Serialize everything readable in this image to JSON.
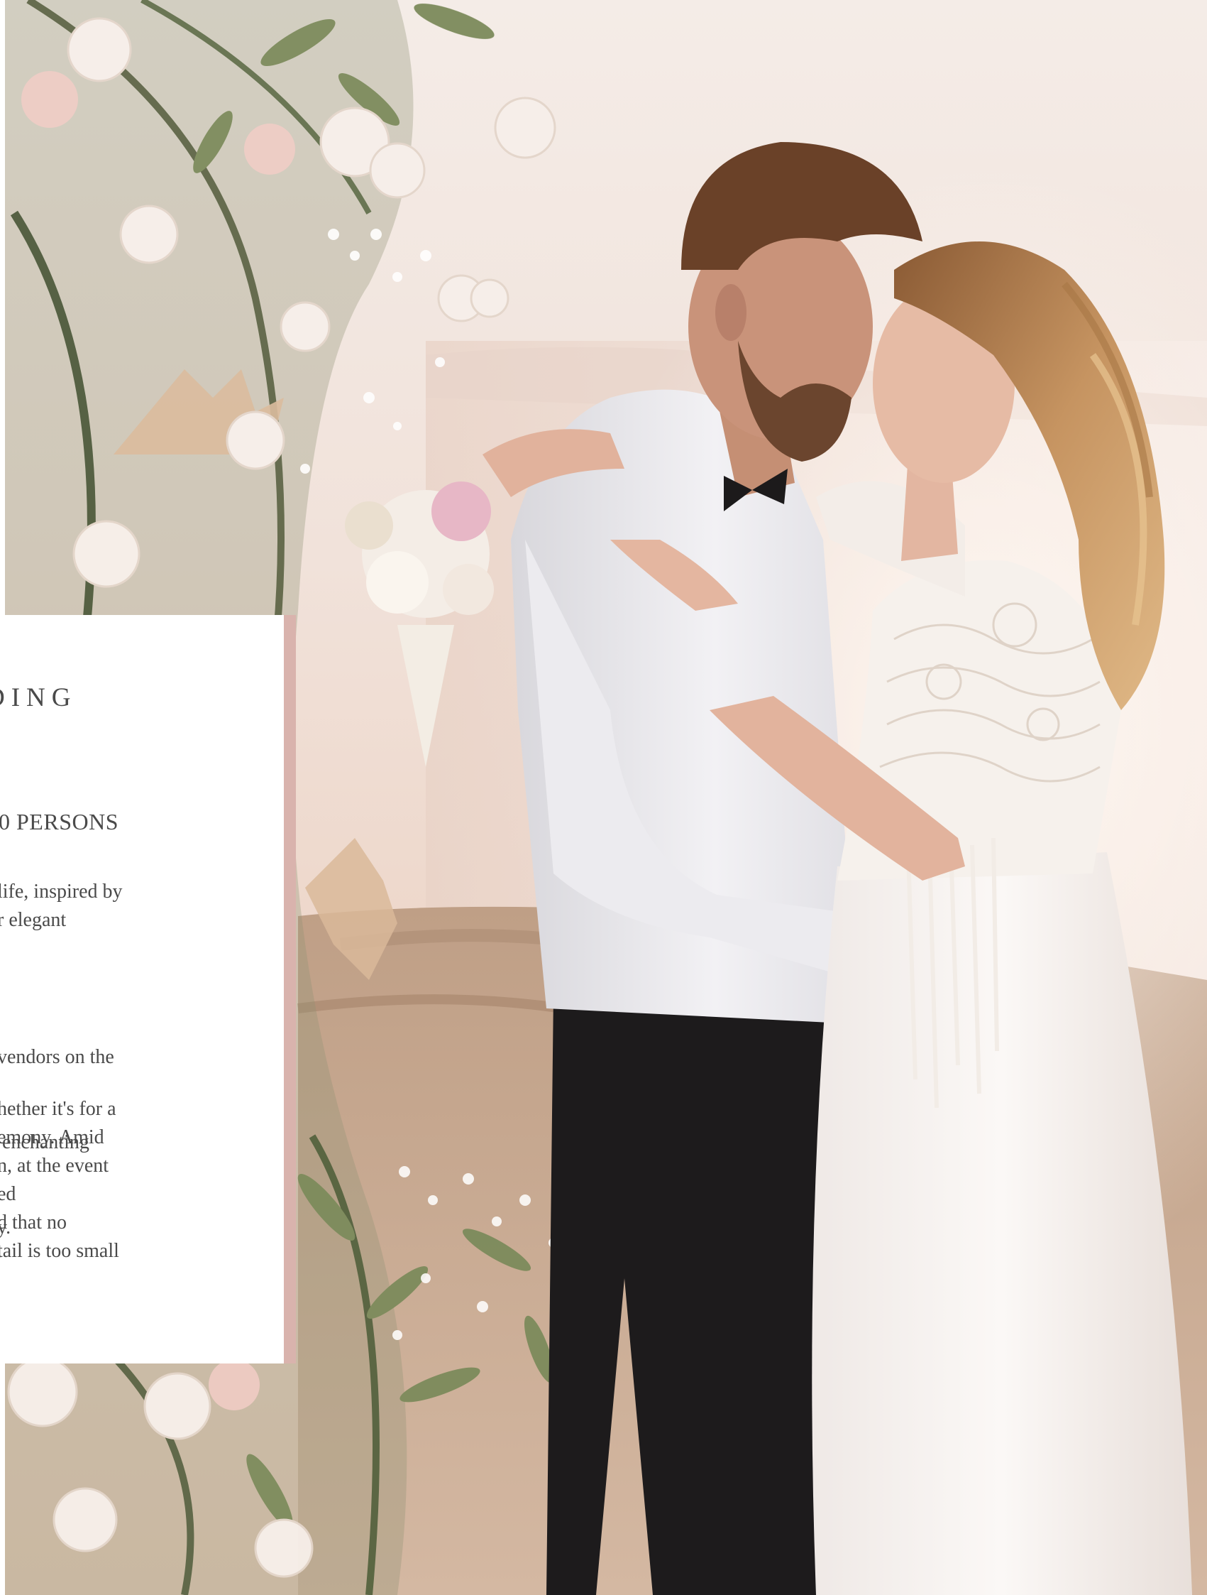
{
  "card": {
    "heading": "DING",
    "capacity": "0 PERSONS",
    "paragraph_1": [
      "life, inspired by",
      "r elegant"
    ],
    "paragraph_2": [
      "vendors on the",
      " enchanting",
      "y."
    ],
    "paragraph_3": [
      "hether it's for a",
      "emony. Amid",
      "n, at the event",
      "ed",
      "d that no",
      "tail is too small"
    ]
  },
  "colors": {
    "card_background": "#ffffff",
    "accent_strip": "#d9b3ad",
    "text": "#4a4a4a"
  },
  "photo": {
    "subject": "bride-and-groom-embracing-beside-floral-arch"
  }
}
